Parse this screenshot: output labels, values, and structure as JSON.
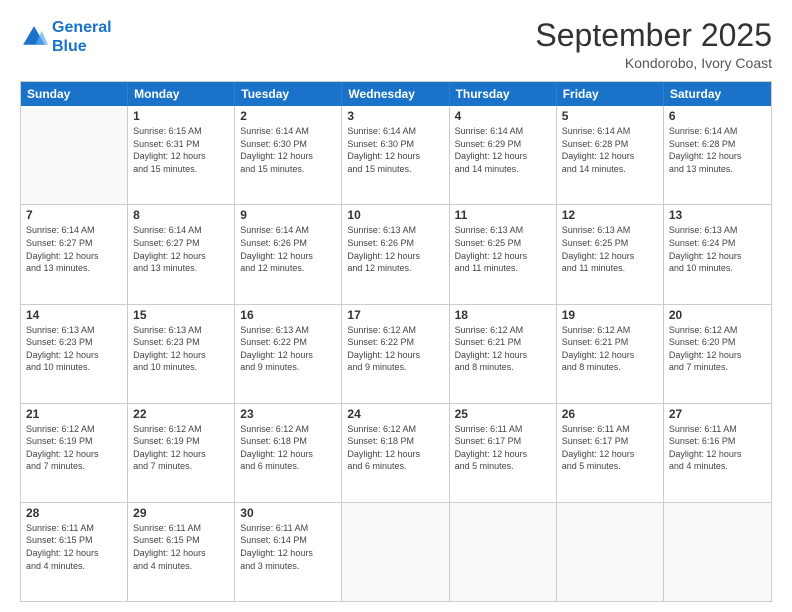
{
  "header": {
    "logo_line1": "General",
    "logo_line2": "Blue",
    "month": "September 2025",
    "location": "Kondorobo, Ivory Coast"
  },
  "weekdays": [
    "Sunday",
    "Monday",
    "Tuesday",
    "Wednesday",
    "Thursday",
    "Friday",
    "Saturday"
  ],
  "rows": [
    [
      {
        "day": "",
        "empty": true
      },
      {
        "day": "1",
        "info": "Sunrise: 6:15 AM\nSunset: 6:31 PM\nDaylight: 12 hours\nand 15 minutes."
      },
      {
        "day": "2",
        "info": "Sunrise: 6:14 AM\nSunset: 6:30 PM\nDaylight: 12 hours\nand 15 minutes."
      },
      {
        "day": "3",
        "info": "Sunrise: 6:14 AM\nSunset: 6:30 PM\nDaylight: 12 hours\nand 15 minutes."
      },
      {
        "day": "4",
        "info": "Sunrise: 6:14 AM\nSunset: 6:29 PM\nDaylight: 12 hours\nand 14 minutes."
      },
      {
        "day": "5",
        "info": "Sunrise: 6:14 AM\nSunset: 6:28 PM\nDaylight: 12 hours\nand 14 minutes."
      },
      {
        "day": "6",
        "info": "Sunrise: 6:14 AM\nSunset: 6:28 PM\nDaylight: 12 hours\nand 13 minutes."
      }
    ],
    [
      {
        "day": "7",
        "info": "Sunrise: 6:14 AM\nSunset: 6:27 PM\nDaylight: 12 hours\nand 13 minutes."
      },
      {
        "day": "8",
        "info": "Sunrise: 6:14 AM\nSunset: 6:27 PM\nDaylight: 12 hours\nand 13 minutes."
      },
      {
        "day": "9",
        "info": "Sunrise: 6:14 AM\nSunset: 6:26 PM\nDaylight: 12 hours\nand 12 minutes."
      },
      {
        "day": "10",
        "info": "Sunrise: 6:13 AM\nSunset: 6:26 PM\nDaylight: 12 hours\nand 12 minutes."
      },
      {
        "day": "11",
        "info": "Sunrise: 6:13 AM\nSunset: 6:25 PM\nDaylight: 12 hours\nand 11 minutes."
      },
      {
        "day": "12",
        "info": "Sunrise: 6:13 AM\nSunset: 6:25 PM\nDaylight: 12 hours\nand 11 minutes."
      },
      {
        "day": "13",
        "info": "Sunrise: 6:13 AM\nSunset: 6:24 PM\nDaylight: 12 hours\nand 10 minutes."
      }
    ],
    [
      {
        "day": "14",
        "info": "Sunrise: 6:13 AM\nSunset: 6:23 PM\nDaylight: 12 hours\nand 10 minutes."
      },
      {
        "day": "15",
        "info": "Sunrise: 6:13 AM\nSunset: 6:23 PM\nDaylight: 12 hours\nand 10 minutes."
      },
      {
        "day": "16",
        "info": "Sunrise: 6:13 AM\nSunset: 6:22 PM\nDaylight: 12 hours\nand 9 minutes."
      },
      {
        "day": "17",
        "info": "Sunrise: 6:12 AM\nSunset: 6:22 PM\nDaylight: 12 hours\nand 9 minutes."
      },
      {
        "day": "18",
        "info": "Sunrise: 6:12 AM\nSunset: 6:21 PM\nDaylight: 12 hours\nand 8 minutes."
      },
      {
        "day": "19",
        "info": "Sunrise: 6:12 AM\nSunset: 6:21 PM\nDaylight: 12 hours\nand 8 minutes."
      },
      {
        "day": "20",
        "info": "Sunrise: 6:12 AM\nSunset: 6:20 PM\nDaylight: 12 hours\nand 7 minutes."
      }
    ],
    [
      {
        "day": "21",
        "info": "Sunrise: 6:12 AM\nSunset: 6:19 PM\nDaylight: 12 hours\nand 7 minutes."
      },
      {
        "day": "22",
        "info": "Sunrise: 6:12 AM\nSunset: 6:19 PM\nDaylight: 12 hours\nand 7 minutes."
      },
      {
        "day": "23",
        "info": "Sunrise: 6:12 AM\nSunset: 6:18 PM\nDaylight: 12 hours\nand 6 minutes."
      },
      {
        "day": "24",
        "info": "Sunrise: 6:12 AM\nSunset: 6:18 PM\nDaylight: 12 hours\nand 6 minutes."
      },
      {
        "day": "25",
        "info": "Sunrise: 6:11 AM\nSunset: 6:17 PM\nDaylight: 12 hours\nand 5 minutes."
      },
      {
        "day": "26",
        "info": "Sunrise: 6:11 AM\nSunset: 6:17 PM\nDaylight: 12 hours\nand 5 minutes."
      },
      {
        "day": "27",
        "info": "Sunrise: 6:11 AM\nSunset: 6:16 PM\nDaylight: 12 hours\nand 4 minutes."
      }
    ],
    [
      {
        "day": "28",
        "info": "Sunrise: 6:11 AM\nSunset: 6:15 PM\nDaylight: 12 hours\nand 4 minutes."
      },
      {
        "day": "29",
        "info": "Sunrise: 6:11 AM\nSunset: 6:15 PM\nDaylight: 12 hours\nand 4 minutes."
      },
      {
        "day": "30",
        "info": "Sunrise: 6:11 AM\nSunset: 6:14 PM\nDaylight: 12 hours\nand 3 minutes."
      },
      {
        "day": "",
        "empty": true
      },
      {
        "day": "",
        "empty": true
      },
      {
        "day": "",
        "empty": true
      },
      {
        "day": "",
        "empty": true
      }
    ]
  ]
}
